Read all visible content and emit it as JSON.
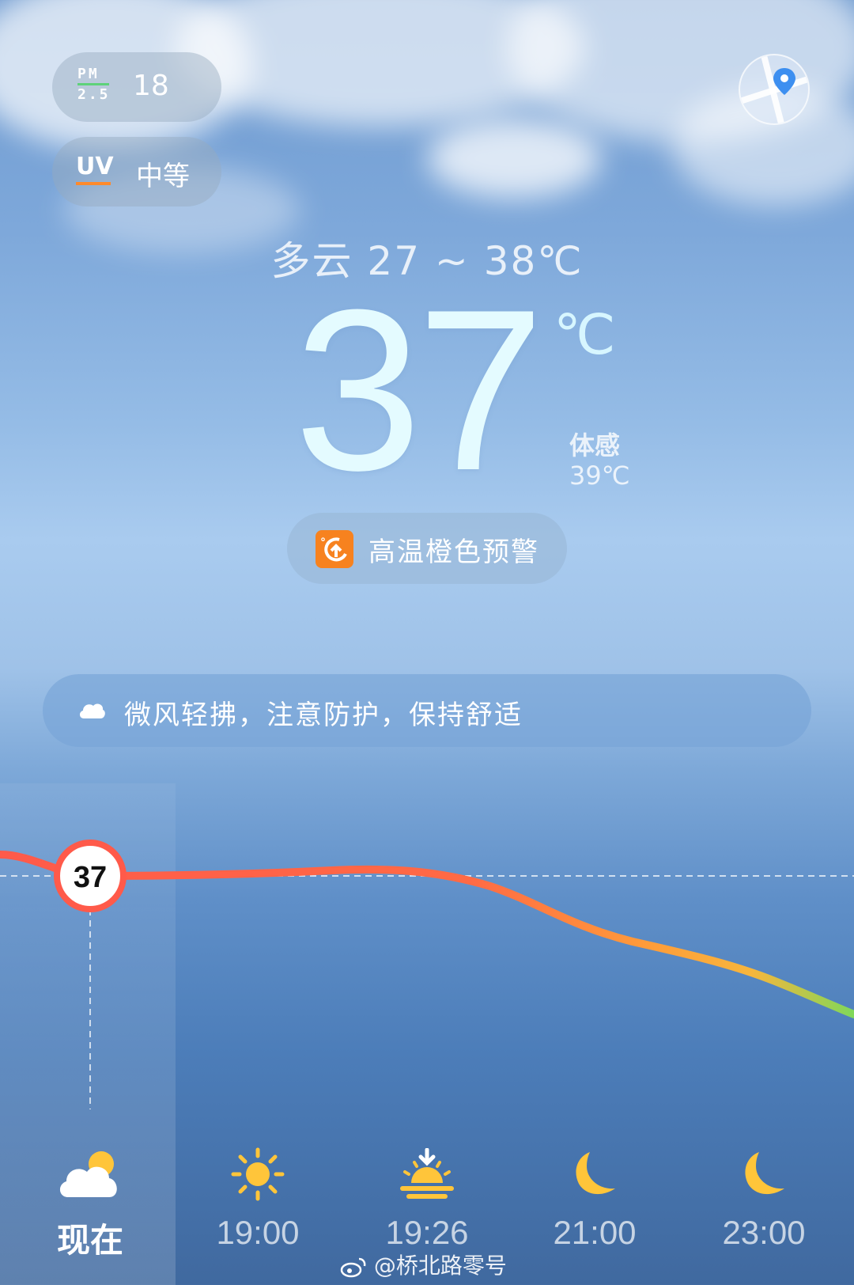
{
  "air": {
    "pm_label_top": "PM",
    "pm_label_bottom": "2.5",
    "pm_value": "18",
    "uv_label": "UV",
    "uv_value": "中等"
  },
  "current": {
    "summary": "多云  27 ~ 38℃",
    "temperature": "37",
    "unit": "℃",
    "feels_like_label": "体感",
    "feels_like_value": "39℃"
  },
  "warning": {
    "icon": "high-temp-warning-icon",
    "label": "高温橙色预警",
    "color": "#f7821f"
  },
  "tip": {
    "icon": "cloud-icon",
    "text": "微风轻拂，注意防护，保持舒适"
  },
  "hourly": [
    {
      "time": "现在",
      "icon": "partly-cloudy-icon",
      "temp": "37"
    },
    {
      "time": "19:00",
      "icon": "sun-icon"
    },
    {
      "time": "19:26",
      "icon": "sunset-icon"
    },
    {
      "time": "21:00",
      "icon": "moon-icon"
    },
    {
      "time": "23:00",
      "icon": "moon-icon"
    }
  ],
  "watermark": "@桥北路零号"
}
